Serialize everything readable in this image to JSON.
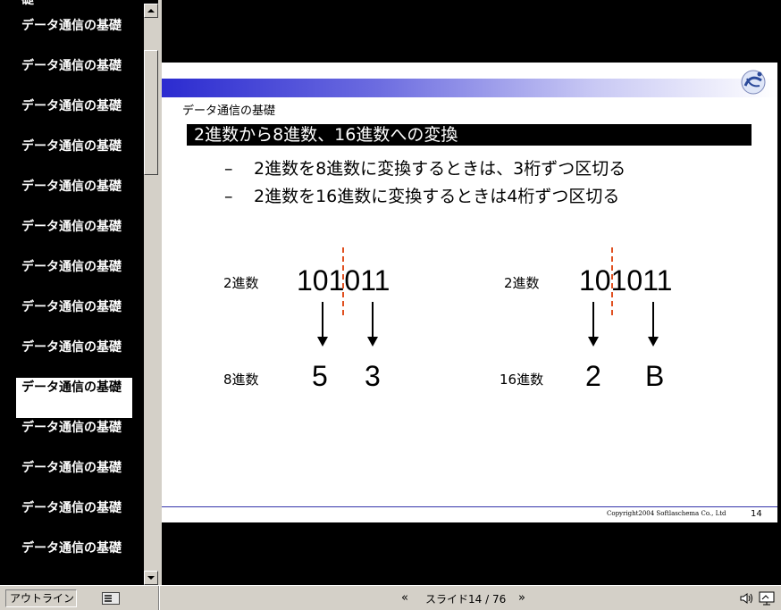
{
  "outline": {
    "items": [
      "礎",
      "データ通信の基礎",
      "データ通信の基礎",
      "データ通信の基礎",
      "データ通信の基礎",
      "データ通信の基礎",
      "データ通信の基礎",
      "データ通信の基礎",
      "データ通信の基礎",
      "データ通信の基礎",
      "データ通信の基礎",
      "データ通信の基礎",
      "データ通信の基礎",
      "データ通信の基礎",
      "データ通信の基礎"
    ],
    "selected_index": 10
  },
  "slide": {
    "header": "データ通信の基礎",
    "title": "2進数から8進数、16進数への変換",
    "bullets": [
      {
        "dash": "–",
        "text": "2進数を8進数に変換するときは、3桁ずつ区切る"
      },
      {
        "dash": "–",
        "text": "2進数を16進数に変換するときは4桁ずつ区切る"
      }
    ],
    "left_example": {
      "binary_label": "2進数",
      "binary_value": "101011",
      "result_label": "8進数",
      "results": [
        "5",
        "3"
      ]
    },
    "right_example": {
      "binary_label": "2進数",
      "binary_value": "101011",
      "result_label": "16進数",
      "results": [
        "2",
        "B"
      ]
    },
    "copyright": "Copyright2004 Softlaschema Co., Ltd",
    "page_number": "14"
  },
  "statusbar": {
    "outline_button": "アウトライン",
    "prev": "«",
    "counter": "スライド14 / 76",
    "next": "»",
    "icons": [
      "slide-view-icon",
      "sound-icon",
      "screen-icon"
    ]
  },
  "colors": {
    "accent_blue": "#2b2bd0",
    "divider_red": "#e05020",
    "chrome": "#d4d0c8"
  }
}
